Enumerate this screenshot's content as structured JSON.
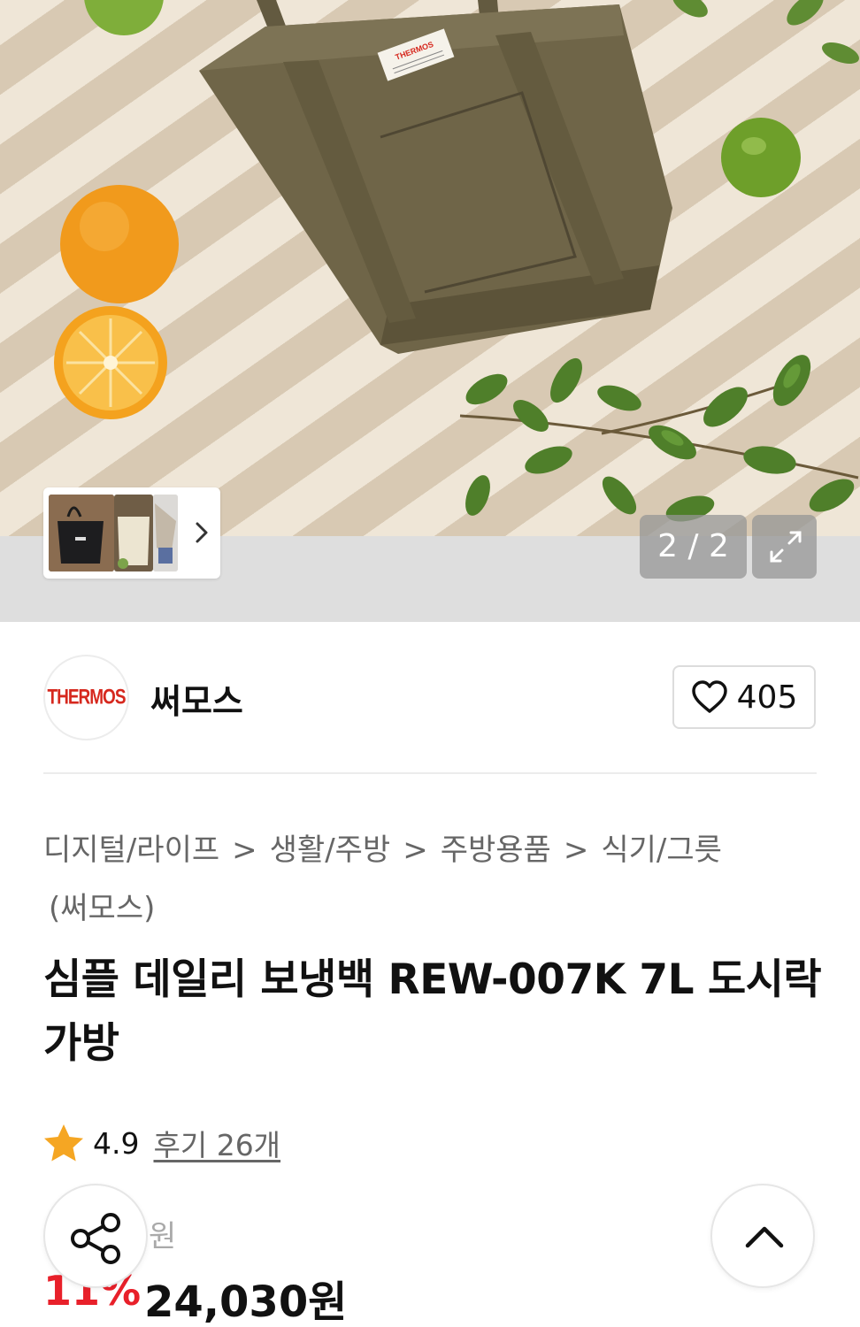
{
  "gallery": {
    "counter": "2 / 2",
    "thumbnail_next_icon": "chevron-right-icon",
    "expand_icon": "expand-icon",
    "product_label": "THERMOS"
  },
  "brand": {
    "logo_text": "THERMOS",
    "name": "써모스",
    "like_icon": "heart-outline-icon",
    "like_count": "405",
    "logo_color": "#d6281e"
  },
  "breadcrumb": {
    "items": [
      "디지털/라이프",
      "생활/주방",
      "주방용품",
      "식기/그릇"
    ],
    "separator": ">",
    "brand_suffix": "(써모스)"
  },
  "product": {
    "title": "심플 데일리 보냉백 REW-007K 7L 도시락 가방"
  },
  "rating": {
    "star_icon": "star-icon",
    "score": "4.9",
    "reviews": "후기 26개",
    "star_color": "#f5a623"
  },
  "price": {
    "original_suffix": "원",
    "discount": "11%",
    "sale": "24,030원",
    "discount_color": "#e8202a"
  },
  "floating": {
    "share_icon": "share-icon",
    "top_icon": "chevron-up-icon"
  }
}
